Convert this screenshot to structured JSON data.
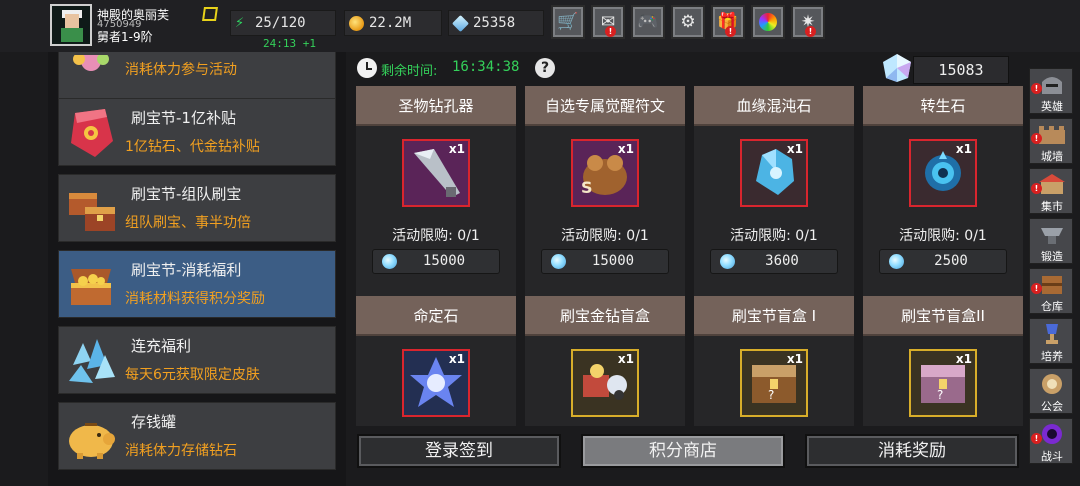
{
  "player": {
    "name": "神殿的奥丽芙",
    "id": "4750949",
    "rank": "舅者1-9阶"
  },
  "stats": {
    "stamina": "25/120",
    "stamina_timer": "24:13 +1",
    "gold": "22.2M",
    "diamonds": "25358"
  },
  "top_icons": [
    {
      "icon": "cart-icon",
      "alert": false
    },
    {
      "icon": "mail-icon",
      "alert": true
    },
    {
      "icon": "gamepad-icon",
      "alert": false
    },
    {
      "icon": "gear-icon",
      "alert": false
    },
    {
      "icon": "gift-icon",
      "alert": true
    },
    {
      "icon": "color-wheel-icon",
      "alert": false
    },
    {
      "icon": "fireworks-icon",
      "alert": true
    }
  ],
  "events": [
    {
      "title": "",
      "sub": "消耗体力参与活动",
      "active": false
    },
    {
      "title": "刷宝节-1亿补贴",
      "sub": "1亿钻石、代金钻补贴",
      "active": false
    },
    {
      "title": "刷宝节-组队刷宝",
      "sub": "组队刷宝、事半功倍",
      "active": false
    },
    {
      "title": "刷宝节-消耗福利",
      "sub": "消耗材料获得积分奖励",
      "active": true
    },
    {
      "title": "连充福利",
      "sub": "每天6元获取限定皮肤",
      "active": false
    },
    {
      "title": "存钱罐",
      "sub": "消耗体力存储钻石",
      "active": false
    }
  ],
  "shop": {
    "timer_label": "剩余时间:",
    "timer_value": "16:34:38",
    "help": "?",
    "balance": "15083",
    "items": [
      {
        "name": "圣物钻孔器",
        "qty": "x1",
        "limit": "活动限购: 0/1",
        "price": "15000"
      },
      {
        "name": "自选专属觉醒符文",
        "qty": "x1",
        "limit": "活动限购: 0/1",
        "price": "15000"
      },
      {
        "name": "血缘混沌石",
        "qty": "x1",
        "limit": "活动限购: 0/1",
        "price": "3600"
      },
      {
        "name": "转生石",
        "qty": "x1",
        "limit": "活动限购: 0/1",
        "price": "2500"
      },
      {
        "name": "命定石",
        "qty": "x1"
      },
      {
        "name": "刷宝金钻盲盒",
        "qty": "x1"
      },
      {
        "name": "刷宝节盲盒 I",
        "qty": "x1"
      },
      {
        "name": "刷宝节盲盒II",
        "qty": "x1"
      }
    ]
  },
  "tabs": [
    "登录签到",
    "积分商店",
    "消耗奖励"
  ],
  "sidebar": [
    {
      "label": "英雄",
      "alert": true
    },
    {
      "label": "城墙",
      "alert": true
    },
    {
      "label": "集市",
      "alert": true
    },
    {
      "label": "锻造",
      "alert": false
    },
    {
      "label": "仓库",
      "alert": true
    },
    {
      "label": "培养",
      "alert": false
    },
    {
      "label": "公会",
      "alert": false
    },
    {
      "label": "战斗",
      "alert": true
    }
  ],
  "colors": {
    "accent_green": "#34d05a",
    "accent_orange": "#f2a020",
    "alert_red": "#d82020",
    "active_tab": "#3c5d85"
  }
}
